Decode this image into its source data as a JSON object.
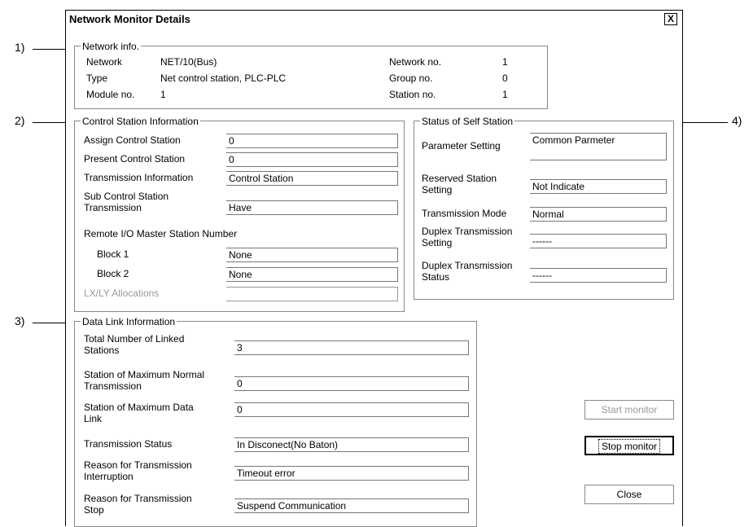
{
  "window": {
    "title": "Network Monitor Details",
    "close_glyph": "X"
  },
  "callouts": {
    "c1": "1)",
    "c2": "2)",
    "c3": "3)",
    "c4": "4)"
  },
  "network_info": {
    "legend": "Network info.",
    "network_label": "Network",
    "network_value": "NET/10(Bus)",
    "type_label": "Type",
    "type_value": "Net control station, PLC-PLC",
    "module_label": "Module no.",
    "module_value": "1",
    "network_no_label": "Network no.",
    "network_no_value": "1",
    "group_no_label": "Group no.",
    "group_no_value": "0",
    "station_no_label": "Station no.",
    "station_no_value": "1"
  },
  "control_station": {
    "legend": "Control Station Information",
    "assign_label": "Assign Control Station",
    "assign_value": "0",
    "present_label": "Present Control Station",
    "present_value": "0",
    "transmission_label": "Transmission Information",
    "transmission_value": "Control Station",
    "sub_label_1": "Sub Control Station",
    "sub_label_2": "Transmission",
    "sub_value": "Have",
    "remote_label": "Remote I/O Master Station Number",
    "block1_label": "Block 1",
    "block1_value": "None",
    "block2_label": "Block 2",
    "block2_value": "None",
    "lxly_label": "LX/LY Allocations",
    "lxly_value": ""
  },
  "self_station": {
    "legend": "Status of Self Station",
    "param_label": "Parameter Setting",
    "param_value": "Common Parmeter",
    "reserved_label_1": "Reserved Station",
    "reserved_label_2": "Setting",
    "reserved_value": "Not Indicate",
    "mode_label": "Transmission Mode",
    "mode_value": "Normal",
    "duplex_setting_label_1": "Duplex Transmission",
    "duplex_setting_label_2": "Setting",
    "duplex_setting_value": "------",
    "duplex_status_label_1": "Duplex Transmission",
    "duplex_status_label_2": "Status",
    "duplex_status_value": "------"
  },
  "data_link": {
    "legend": "Data Link Information",
    "total_label_1": "Total Number of Linked",
    "total_label_2": "Stations",
    "total_value": "3",
    "max_normal_label_1": "Station of Maximum Normal",
    "max_normal_label_2": "Transmission",
    "max_normal_value": "0",
    "max_data_label_1": "Station of Maximum Data",
    "max_data_label_2": "Link",
    "max_data_value": "0",
    "status_label": "Transmission Status",
    "status_value": "In Disconect(No Baton)",
    "interrupt_label_1": "Reason for Transmission",
    "interrupt_label_2": "Interruption",
    "interrupt_value": "Timeout error",
    "stop_label_1": "Reason for Transmission",
    "stop_label_2": "Stop",
    "stop_value": "Suspend Communication"
  },
  "buttons": {
    "start": "Start monitor",
    "stop": "Stop monitor",
    "close": "Close"
  }
}
